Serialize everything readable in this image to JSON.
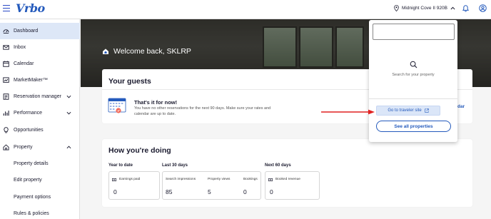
{
  "topbar": {
    "logo": "Vrbo",
    "property_name": "Midnight Cove II 920B"
  },
  "sidebar": {
    "items": [
      {
        "label": "Dashboard",
        "icon": "dashboard-icon",
        "active": true
      },
      {
        "label": "Inbox",
        "icon": "mail-icon"
      },
      {
        "label": "Calendar",
        "icon": "calendar-icon"
      },
      {
        "label": "MarketMaker™",
        "icon": "chart-icon"
      },
      {
        "label": "Reservation manager",
        "icon": "reservation-icon",
        "expandable": true
      },
      {
        "label": "Performance",
        "icon": "bar-chart-icon",
        "expandable": true
      },
      {
        "label": "Opportunities",
        "icon": "lightbulb-icon"
      },
      {
        "label": "Property",
        "icon": "house-icon",
        "expandable": true,
        "expanded": true
      },
      {
        "label": "Property details"
      },
      {
        "label": "Edit property"
      },
      {
        "label": "Payment options"
      },
      {
        "label": "Rules & policies"
      }
    ]
  },
  "hero": {
    "welcome": "Welcome back, SKLRP"
  },
  "guests": {
    "title": "Your guests",
    "heading": "That's it for now!",
    "text": "You have no other reservations for the next 90 days. Make sure your rates and calendar are up to date.",
    "link_fragment": "dar"
  },
  "doing": {
    "title": "How you're doing",
    "year_to_date": {
      "label": "Year to date",
      "earnings_label": "Earnings paid",
      "earnings_value": "0"
    },
    "last_30": {
      "label": "Last 30 days",
      "impressions_label": "Search impressions",
      "impressions_value": "85",
      "views_label": "Property views",
      "views_value": "5",
      "bookings_label": "Bookings",
      "bookings_value": "0"
    },
    "next_60": {
      "label": "Next 60 days",
      "revenue_label": "Booked revenue",
      "revenue_value": "0"
    }
  },
  "dropdown": {
    "search_value": "",
    "hint": "Search for your property",
    "traveler_button": "Go to traveler site",
    "all_button": "See all properties"
  },
  "colors": {
    "brand": "#245abc",
    "active_nav": "#dde7f7",
    "annotation_arrow": "#e02020"
  }
}
